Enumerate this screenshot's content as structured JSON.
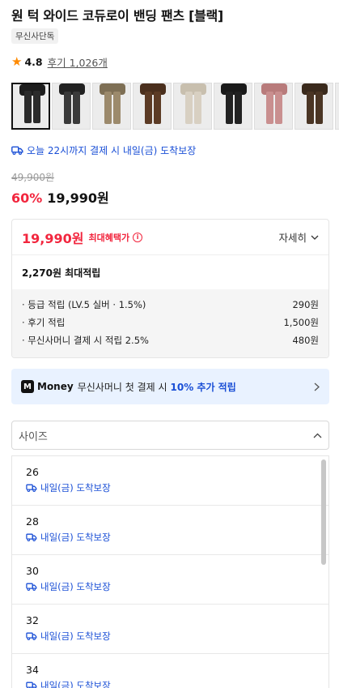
{
  "product": {
    "title": "원 턱 와이드 코듀로이 밴딩 팬츠 [블랙]",
    "badge": "무신사단독"
  },
  "rating": {
    "score": "4.8",
    "reviews": "후기 1,026개"
  },
  "thumbnails": [
    {
      "colors": [
        "#2b2b2b",
        "#1d1d1d"
      ]
    },
    {
      "colors": [
        "#3a3a3a",
        "#222222"
      ]
    },
    {
      "colors": [
        "#9c8a6c",
        "#7e6f55"
      ]
    },
    {
      "colors": [
        "#5c3b25",
        "#4a2f1d"
      ]
    },
    {
      "colors": [
        "#d8d0c2",
        "#c8bfae"
      ]
    },
    {
      "colors": [
        "#222222",
        "#1a1a1a"
      ]
    },
    {
      "colors": [
        "#c98f8f",
        "#b87b7b"
      ]
    },
    {
      "colors": [
        "#4a3524",
        "#3a2a1c"
      ]
    },
    {
      "colors": [
        "#bdb39c",
        "#a89d85"
      ]
    }
  ],
  "delivery": {
    "text": "오늘 22시까지 결제 시 내일(금) 도착보장"
  },
  "price": {
    "original": "49,900원",
    "discount": "60%",
    "sale": "19,990원"
  },
  "benefit": {
    "price": "19,990원",
    "label": "최대혜택가",
    "detail_label": "자세히",
    "points_summary": "2,270원 최대적립",
    "points": [
      {
        "label": "· 등급 적립 (LV.5 실버 · 1.5%)",
        "value": "290원"
      },
      {
        "label": "· 후기 적립",
        "value": "1,500원"
      },
      {
        "label": "· 무신사머니 결제 시 적립 2.5%",
        "value": "480원"
      }
    ]
  },
  "money_banner": {
    "logo": "M",
    "brand": "Money",
    "text": "무신사머니 첫 결제 시",
    "highlight": "10% 추가 적립"
  },
  "size_select": {
    "placeholder": "사이즈"
  },
  "sizes": [
    {
      "label": "26",
      "delivery": "내일(금) 도착보장"
    },
    {
      "label": "28",
      "delivery": "내일(금) 도착보장"
    },
    {
      "label": "30",
      "delivery": "내일(금) 도착보장"
    },
    {
      "label": "32",
      "delivery": "내일(금) 도착보장"
    },
    {
      "label": "34",
      "delivery": "내일(금) 도착보장"
    }
  ],
  "colors": {
    "accent_red": "#f2263e",
    "accent_blue": "#1a4fd6",
    "star": "#ff8a00"
  }
}
